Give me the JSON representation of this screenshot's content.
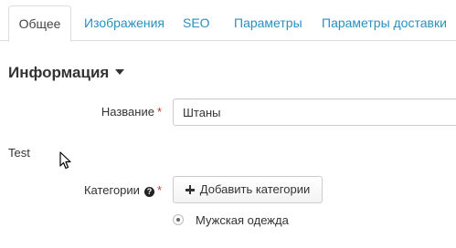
{
  "tabs": [
    {
      "label": "Общее",
      "active": true
    },
    {
      "label": "Изображения",
      "active": false
    },
    {
      "label": "SEO",
      "active": false
    },
    {
      "label": "Параметры",
      "active": false
    },
    {
      "label": "Параметры доставки",
      "active": false
    }
  ],
  "section": {
    "title": "Информация"
  },
  "form": {
    "name_label": "Название",
    "required_mark": "*",
    "name_value": "Штаны",
    "free_text": "Test",
    "categories_label": "Категории",
    "help_glyph": "?",
    "add_categories_label": "Добавить категории",
    "category_option": "Мужская одежда"
  },
  "colors": {
    "link": "#2a8fbd",
    "required": "#c0392b",
    "border": "#dddddd"
  },
  "icons": [
    "caret-down-icon",
    "help-icon",
    "plus-icon",
    "radio-icon",
    "mouse-cursor-icon"
  ]
}
